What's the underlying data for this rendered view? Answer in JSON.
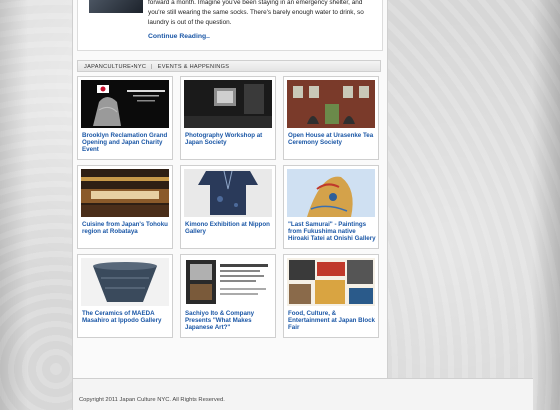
{
  "top_article": {
    "line1": "forward a month. Imagine you've been staying in an emergency shelter, and",
    "line2": "you're still wearing the same socks. There's barely enough water to drink, so",
    "line3": "laundry is out of the question.",
    "continue_label": "Continue Reading.."
  },
  "section": {
    "brand": "JAPANCULTURE•NYC",
    "separator": "|",
    "title": "EVENTS & HAPPENINGS"
  },
  "events": [
    {
      "title": "Brooklyn Reclamation Grand Opening and Japan Charity Event",
      "thumb_icon": "stone-lantern-image",
      "flyer_text": "Join Us For The Light Night At The Night"
    },
    {
      "title": "Photography Workshop at Japan Society",
      "thumb_icon": "dark-room-photo"
    },
    {
      "title": "Open House at Urasenke Tea Ceremony Society",
      "thumb_icon": "brick-building-photo"
    },
    {
      "title": "Cuisine from Japan's Tohoku region at Robataya",
      "thumb_icon": "restaurant-interior-photo"
    },
    {
      "title": "Kimono Exhibition at Nippon Gallery",
      "thumb_icon": "kimono-photo"
    },
    {
      "title": "\"Last Samurai\" - Paintings from Fukushima native Hiroaki Tatei at Onishi Gallery",
      "thumb_icon": "painting-photo"
    },
    {
      "title": "The Ceramics of MAEDA Masahiro at Ippodo Gallery",
      "thumb_icon": "ceramic-bowl-photo"
    },
    {
      "title": "Sachiyo Ito & Company Presents \"What Makes Japanese Art?\"",
      "thumb_icon": "event-flyer-image"
    },
    {
      "title": "Food, Culture, & Entertainment at Japan Block Fair",
      "thumb_icon": "collage-flyer-image"
    }
  ],
  "footer": {
    "copyright": "Copyright 2011 Japan Culture NYC. All Rights Reserved."
  }
}
